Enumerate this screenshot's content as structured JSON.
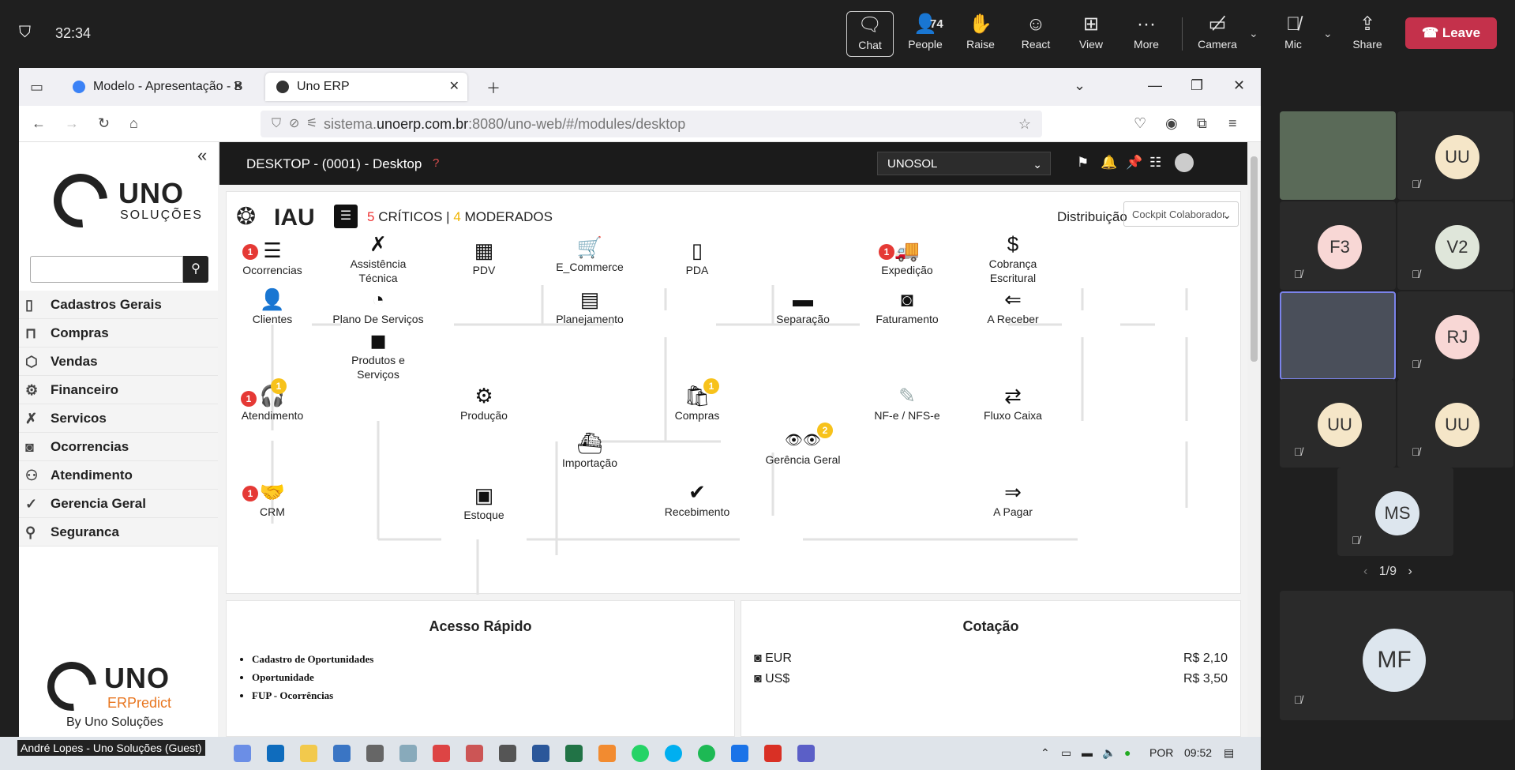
{
  "meeting": {
    "timer": "32:34",
    "buttons": [
      {
        "label": "Chat",
        "icon": "chat-icon"
      },
      {
        "label": "People",
        "icon": "people-icon",
        "count": "74"
      },
      {
        "label": "Raise",
        "icon": "raise-hand-icon"
      },
      {
        "label": "React",
        "icon": "react-icon"
      },
      {
        "label": "View",
        "icon": "view-icon"
      },
      {
        "label": "More",
        "icon": "more-icon"
      },
      {
        "label": "Camera",
        "icon": "camera-off-icon"
      },
      {
        "label": "Mic",
        "icon": "mic-off-icon"
      },
      {
        "label": "Share",
        "icon": "share-icon"
      }
    ],
    "leave_label": "Leave",
    "participants": [
      "UU",
      "F3",
      "V2",
      "RJ",
      "UU",
      "UU",
      "MS",
      "MF"
    ],
    "pager": "1/9",
    "caption": "André Lopes - Uno Soluções (Guest)"
  },
  "browser": {
    "tabs": [
      "Modelo - Apresentação - B",
      "Uno ERP"
    ],
    "url_prefix": "sistema.",
    "url_domain": "unoerp.com.br",
    "url_rest": ":8080/uno-web/#/modules/desktop"
  },
  "app": {
    "logo_main": "UNO",
    "logo_sub": "SOLUÇÕES",
    "menu": [
      {
        "label": "Cadastros Gerais",
        "icon": "document-icon"
      },
      {
        "label": "Compras",
        "icon": "bag-icon"
      },
      {
        "label": "Vendas",
        "icon": "box-icon"
      },
      {
        "label": "Financeiro",
        "icon": "gear-icon"
      },
      {
        "label": "Servicos",
        "icon": "wrench-icon"
      },
      {
        "label": "Ocorrencias",
        "icon": "camera-icon"
      },
      {
        "label": "Atendimento",
        "icon": "users-icon"
      },
      {
        "label": "Gerencia Geral",
        "icon": "check-circle-icon"
      },
      {
        "label": "Seguranca",
        "icon": "search-person-icon"
      }
    ],
    "footer_logo_main": "UNO",
    "footer_logo_sub": "ERPredict",
    "byline": "By Uno Soluções",
    "header_title": "DESKTOP - (0001) - Desktop",
    "company": "UNOSOL",
    "iau": {
      "title": "IAU",
      "criticos_count": "5",
      "criticos_label": "CRÍTICOS",
      "sep": "|",
      "moderados_count": "4",
      "moderados_label": "MODERADOS",
      "distribuicao_label": "Distribuição",
      "distribuicao_value": "Cockpit Colaborador"
    },
    "nodes": [
      {
        "id": "ocorrencias",
        "label": "Ocorrencias",
        "glyph": "☰",
        "badge_red": "1"
      },
      {
        "id": "assistencia",
        "label": "Assistência\nTécnica",
        "glyph": "✗"
      },
      {
        "id": "pdv",
        "label": "PDV",
        "glyph": "▦"
      },
      {
        "id": "ecommerce",
        "label": "E_Commerce",
        "glyph": "🛒"
      },
      {
        "id": "pda",
        "label": "PDA",
        "glyph": "▯"
      },
      {
        "id": "expedicao",
        "label": "Expedição",
        "glyph": "🚚",
        "badge_red": "1"
      },
      {
        "id": "cobranca",
        "label": "Cobrança\nEscritural",
        "glyph": "$"
      },
      {
        "id": "clientes",
        "label": "Clientes",
        "glyph": "👤"
      },
      {
        "id": "plano",
        "label": "Plano De Serviços",
        "glyph": "◔"
      },
      {
        "id": "planejamento",
        "label": "Planejamento",
        "glyph": "▤"
      },
      {
        "id": "separacao",
        "label": "Separação",
        "glyph": "▬"
      },
      {
        "id": "faturamento",
        "label": "Faturamento",
        "glyph": "◙"
      },
      {
        "id": "areceber",
        "label": "A Receber",
        "glyph": "⇐"
      },
      {
        "id": "produtos",
        "label": "Produtos e\nServiços",
        "glyph": "◼"
      },
      {
        "id": "atendimento",
        "label": "Atendimento",
        "glyph": "🎧",
        "badge_red": "1",
        "badge_yel": "1"
      },
      {
        "id": "producao",
        "label": "Produção",
        "glyph": "⚙"
      },
      {
        "id": "compras",
        "label": "Compras",
        "glyph": "🛍",
        "badge_yel": "1"
      },
      {
        "id": "nfe",
        "label": "NF-e / NFS-e",
        "glyph": "✎"
      },
      {
        "id": "fluxo",
        "label": "Fluxo Caixa",
        "glyph": "⇄"
      },
      {
        "id": "importacao",
        "label": "Importação",
        "glyph": "⛴"
      },
      {
        "id": "gerencia",
        "label": "Gerência Geral",
        "glyph": "👁👁",
        "badge_yel": "2"
      },
      {
        "id": "crm",
        "label": "CRM",
        "glyph": "🤝",
        "badge_red": "1"
      },
      {
        "id": "estoque",
        "label": "Estoque",
        "glyph": "▣"
      },
      {
        "id": "recebimento",
        "label": "Recebimento",
        "glyph": "✔"
      },
      {
        "id": "apagar",
        "label": "A Pagar",
        "glyph": "⇒"
      }
    ],
    "acesso_rapido": {
      "title": "Acesso Rápido",
      "items": [
        "Cadastro de Oportunidades",
        "Oportunidade",
        "FUP - Ocorrências"
      ]
    },
    "cotacao": {
      "title": "Cotação",
      "rows": [
        {
          "currency": "EUR",
          "value": "R$ 2,10"
        },
        {
          "currency": "US$",
          "value": "R$ 3,50"
        }
      ]
    }
  },
  "taskbar": {
    "lang": "POR",
    "time": "09:52"
  }
}
